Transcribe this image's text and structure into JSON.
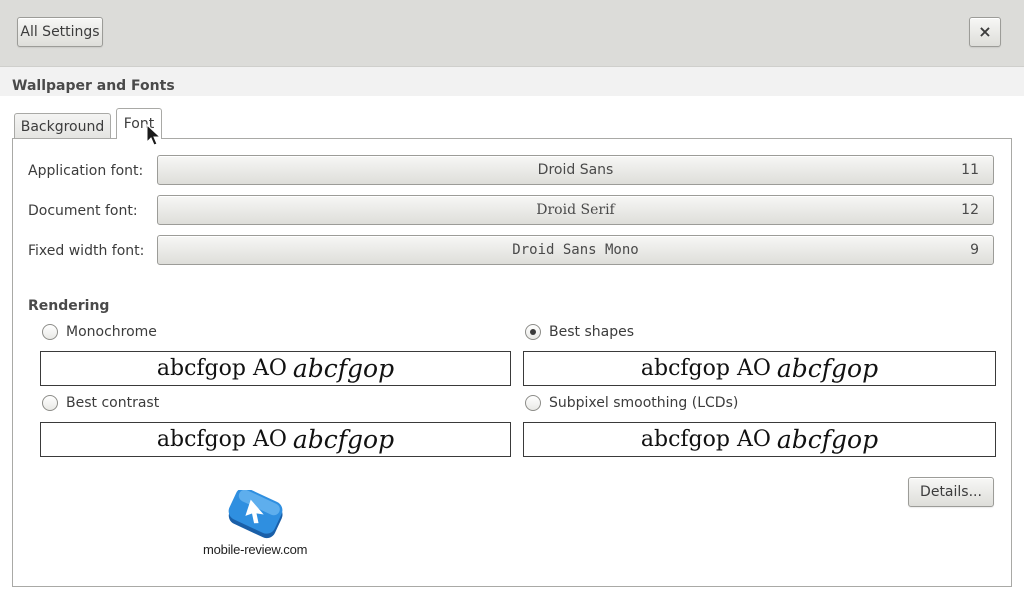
{
  "header": {
    "all_settings_label": "All Settings",
    "close_label": "×"
  },
  "panel": {
    "title": "Wallpaper and Fonts"
  },
  "tabs": [
    {
      "label": "Background",
      "active": false
    },
    {
      "label": "Font",
      "active": true
    }
  ],
  "fonts": {
    "application": {
      "label": "Application font:",
      "name": "Droid Sans",
      "size": "11"
    },
    "document": {
      "label": "Document font:",
      "name": "Droid Serif",
      "size": "12"
    },
    "fixed": {
      "label": "Fixed width font:",
      "name": "Droid Sans Mono",
      "size": "9"
    }
  },
  "rendering": {
    "title": "Rendering",
    "options": [
      {
        "label": "Monochrome",
        "checked": false
      },
      {
        "label": "Best shapes",
        "checked": true
      },
      {
        "label": "Best contrast",
        "checked": false
      },
      {
        "label": "Subpixel smoothing (LCDs)",
        "checked": false
      }
    ],
    "preview_regular": "abcfgop AO",
    "preview_italic": "abcfgop"
  },
  "details_label": "Details...",
  "watermark": {
    "text": "mobile-review.com"
  }
}
